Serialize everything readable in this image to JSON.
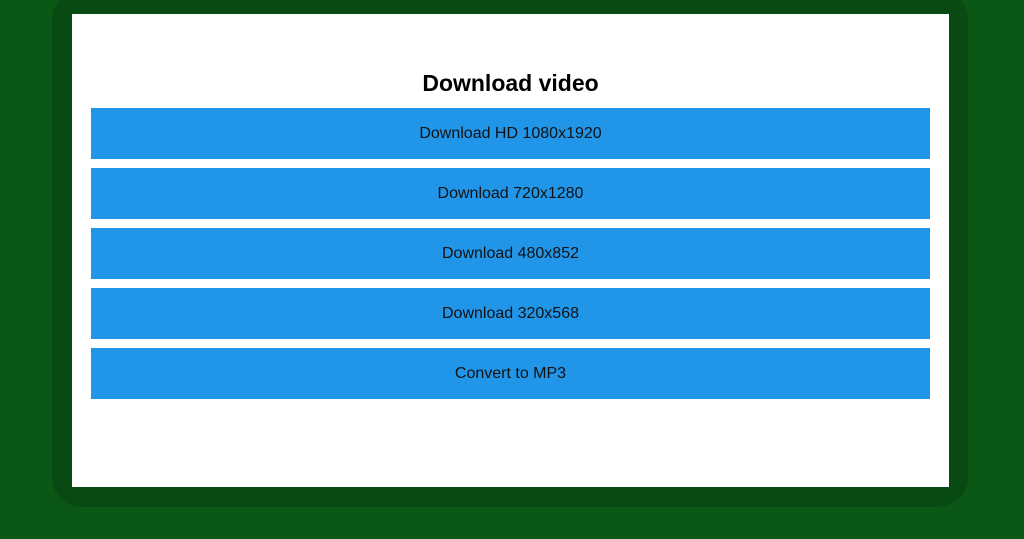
{
  "dialog": {
    "title": "Download video",
    "options": [
      "Download HD 1080x1920",
      "Download 720x1280",
      "Download 480x852",
      "Download 320x568",
      "Convert to MP3"
    ]
  },
  "colors": {
    "background": "#0b5715",
    "panel": "#ffffff",
    "button": "#2196e9",
    "text": "#111111"
  }
}
